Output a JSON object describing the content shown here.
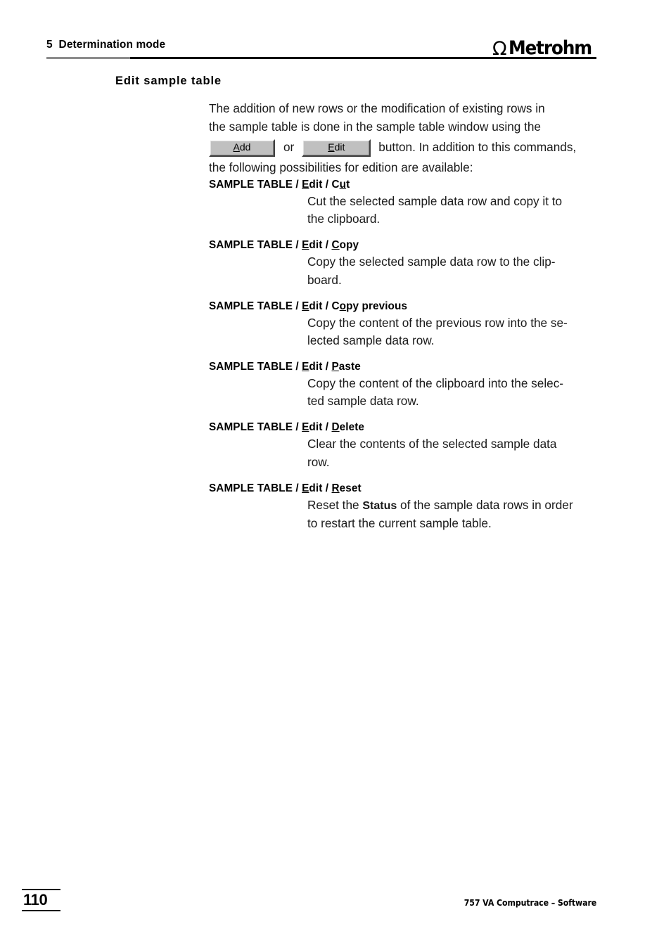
{
  "header": {
    "chapter_title": "5  Determination mode",
    "logo_symbol": "Ω",
    "logo_word": "Metrohm"
  },
  "section": {
    "heading": "Edit sample table"
  },
  "intro": {
    "line1": "The addition of new rows or the modification of existing rows in",
    "line2": "the sample table is done in the sample table window using the",
    "button_add": {
      "mnemonic": "A",
      "rest": "dd",
      "full_label": "Add"
    },
    "connector": "or",
    "button_edit": {
      "mnemonic": "E",
      "rest": "dit",
      "full_label": "Edit"
    },
    "after_buttons": "button. In addition to this commands,",
    "line4": "the following possibilities for edition are available:"
  },
  "entries": [
    {
      "menu_root": "SAMPLE TABLE",
      "sep": " / ",
      "menu_mid_pre": "",
      "menu_mid_mn": "E",
      "menu_mid_post": "dit",
      "menu_leaf_pre": "C",
      "menu_leaf_mn": "u",
      "menu_leaf_post": "t",
      "desc_line1": "Cut the selected sample data row and copy it to",
      "desc_line2": "the clipboard."
    },
    {
      "menu_root": "SAMPLE TABLE",
      "sep": " / ",
      "menu_mid_pre": "",
      "menu_mid_mn": "E",
      "menu_mid_post": "dit",
      "menu_leaf_pre": "",
      "menu_leaf_mn": "C",
      "menu_leaf_post": "opy",
      "desc_line1": "Copy the selected sample data row to the clip-",
      "desc_line2": "board."
    },
    {
      "menu_root": "SAMPLE TABLE",
      "sep": " / ",
      "menu_mid_pre": "",
      "menu_mid_mn": "E",
      "menu_mid_post": "dit",
      "menu_leaf_pre": "C",
      "menu_leaf_mn": "o",
      "menu_leaf_post": "py previous",
      "desc_line1": "Copy the content of the previous row into the se-",
      "desc_line2": "lected sample data row."
    },
    {
      "menu_root": "SAMPLE TABLE",
      "sep": " / ",
      "menu_mid_pre": "",
      "menu_mid_mn": "E",
      "menu_mid_post": "dit",
      "menu_leaf_pre": "",
      "menu_leaf_mn": "P",
      "menu_leaf_post": "aste",
      "desc_line1": "Copy the content of the clipboard into the selec-",
      "desc_line2": "ted sample data row."
    },
    {
      "menu_root": "SAMPLE TABLE",
      "sep": " / ",
      "menu_mid_pre": "",
      "menu_mid_mn": "E",
      "menu_mid_post": "dit",
      "menu_leaf_pre": "",
      "menu_leaf_mn": "D",
      "menu_leaf_post": "elete",
      "desc_line1": "Clear the contents of the selected sample data",
      "desc_line2": "row."
    },
    {
      "menu_root": "SAMPLE TABLE",
      "sep": " / ",
      "menu_mid_pre": "",
      "menu_mid_mn": "E",
      "menu_mid_post": "dit",
      "menu_leaf_pre": "",
      "menu_leaf_mn": "R",
      "menu_leaf_post": "eset",
      "desc_line1_a": "Reset the ",
      "desc_line1_bold": "Status",
      "desc_line1_b": " of the sample data rows in order",
      "desc_line2": "to restart the current sample table."
    }
  ],
  "footer": {
    "page_number": "110",
    "product_line": "757 VA Computrace – Software"
  }
}
